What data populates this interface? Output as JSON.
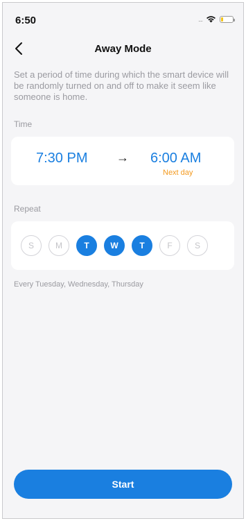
{
  "status_bar": {
    "time": "6:50",
    "signal": "....",
    "battery_level_pct": 15,
    "battery_color": "#f5c518"
  },
  "nav": {
    "title": "Away Mode",
    "back_icon": "chevron-left-icon"
  },
  "description": "Set a period of time during which the smart device will be randomly turned on and off to make it seem like someone is home.",
  "time_section": {
    "label": "Time",
    "start": "7:30 PM",
    "arrow": "→",
    "end": "6:00 AM",
    "end_note": "Next day"
  },
  "repeat_section": {
    "label": "Repeat",
    "days": [
      {
        "letter": "S",
        "selected": false
      },
      {
        "letter": "M",
        "selected": false
      },
      {
        "letter": "T",
        "selected": true
      },
      {
        "letter": "W",
        "selected": true
      },
      {
        "letter": "T",
        "selected": true
      },
      {
        "letter": "F",
        "selected": false
      },
      {
        "letter": "S",
        "selected": false
      }
    ],
    "summary": "Every Tuesday, Wednesday, Thursday"
  },
  "start_button": {
    "label": "Start"
  },
  "colors": {
    "accent": "#1a7fe0",
    "note": "#f39a1f",
    "muted": "#9a9aa0",
    "background": "#f5f5f7"
  }
}
